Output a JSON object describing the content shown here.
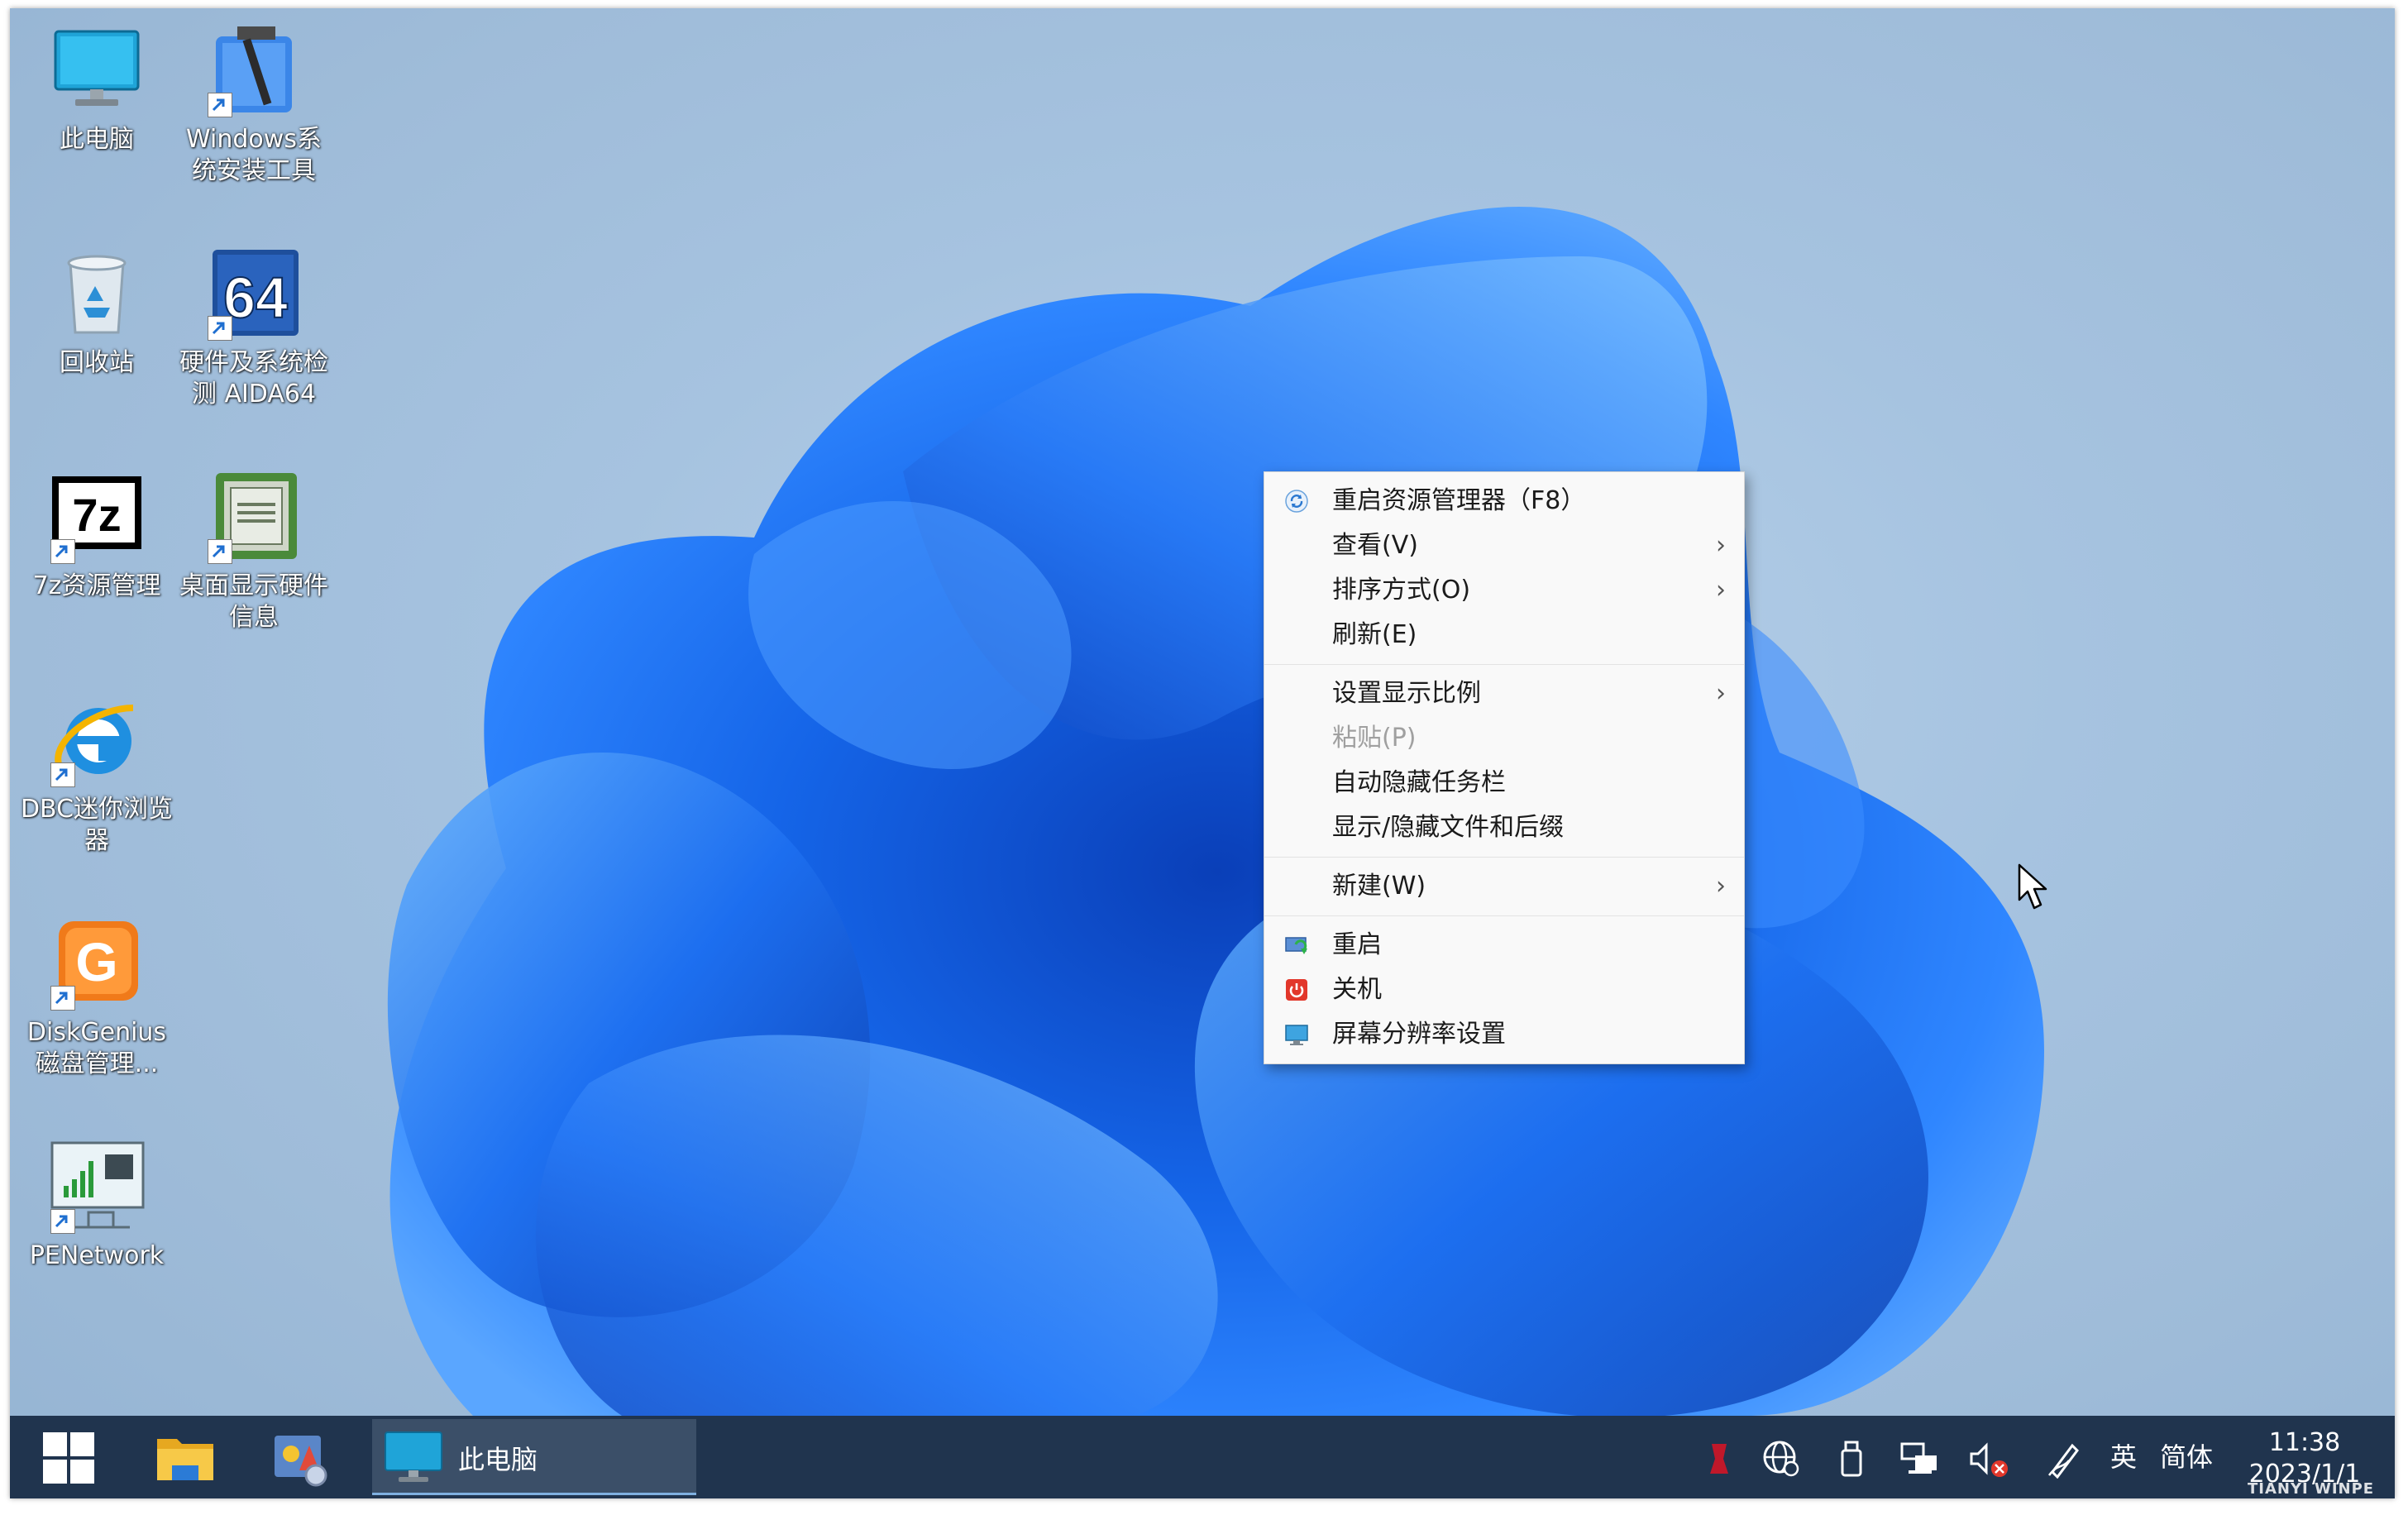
{
  "desktop": {
    "icons": [
      {
        "label": "此电脑"
      },
      {
        "label": "Windows系统安装工具"
      },
      {
        "label": "回收站"
      },
      {
        "label": "硬件及系统检测 AIDA64"
      },
      {
        "label": "7z资源管理"
      },
      {
        "label": "桌面显示硬件信息"
      },
      {
        "label": "DBC迷你浏览器"
      },
      {
        "label": "DiskGenius磁盘管理..."
      },
      {
        "label": "PENetwork"
      }
    ]
  },
  "context_menu": {
    "items": [
      {
        "label": "重启资源管理器（F8）",
        "icon": "refresh-icon"
      },
      {
        "label": "查看(V)",
        "submenu": true
      },
      {
        "label": "排序方式(O)",
        "submenu": true
      },
      {
        "label": "刷新(E)"
      },
      {
        "label": "设置显示比例",
        "submenu": true
      },
      {
        "label": "粘贴(P)",
        "disabled": true
      },
      {
        "label": "自动隐藏任务栏"
      },
      {
        "label": "显示/隐藏文件和后缀"
      },
      {
        "label": "新建(W)",
        "submenu": true
      },
      {
        "label": "重启",
        "icon": "restart-icon"
      },
      {
        "label": "关机",
        "icon": "power-icon"
      },
      {
        "label": "屏幕分辨率设置",
        "icon": "monitor-icon"
      }
    ],
    "arrow": "›"
  },
  "taskbar": {
    "running_app": "此电脑",
    "tray": {
      "ime_lang": "英",
      "ime_mode": "简体"
    },
    "clock": {
      "time": "11:38",
      "date": "2023/1/1"
    },
    "watermark": "TIANYI WINPE"
  },
  "colors": {
    "taskbar": "#20344e",
    "accent": "#1a73e8",
    "menu_bg": "#f9f9f9"
  }
}
